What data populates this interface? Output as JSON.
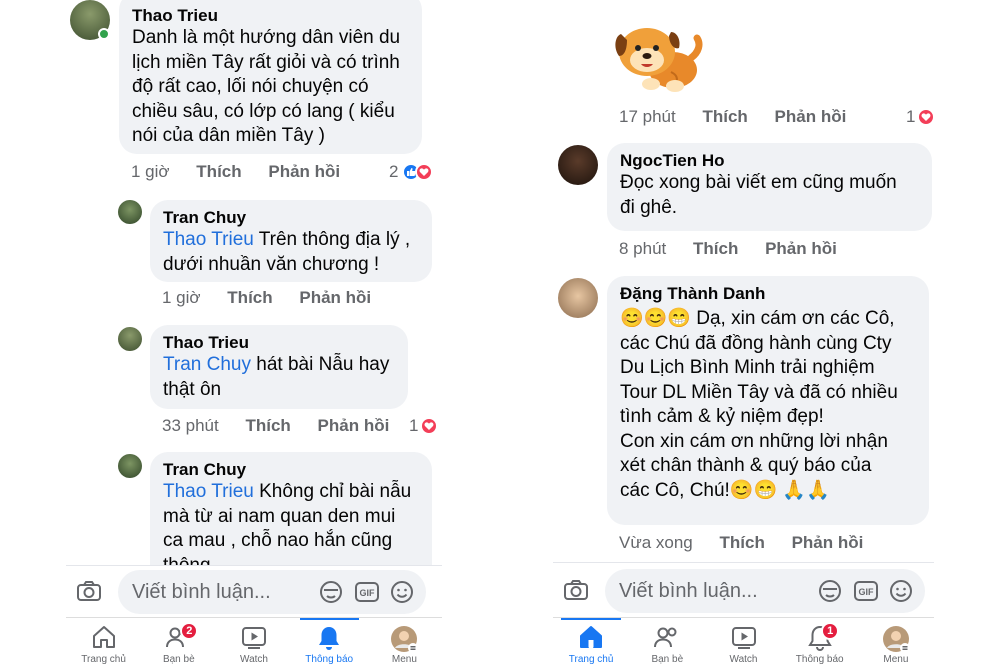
{
  "left": {
    "comments": [
      {
        "name": "Thao Trieu",
        "lines": [
          "Danh là một hướng dân viên du",
          "lịch miền Tây rất giỏi và có trình",
          "độ rất cao, lối nói chuyện có",
          "chiều sâu, có lớp có lang ( kiểu",
          "nói của dân miền Tây )"
        ],
        "time": "1 giờ",
        "like": "Thích",
        "reply": "Phản hồi",
        "reaction_count": "2"
      },
      {
        "name": "Tran Chuy",
        "mention": "Thao Trieu",
        "lines": [
          " Trên thông địa lý ,",
          "dưới nhuần văn chương !"
        ],
        "time": "1 giờ",
        "like": "Thích",
        "reply": "Phản hồi"
      },
      {
        "name": "Thao Trieu",
        "mention": "Tran Chuy",
        "lines": [
          " hát bài Nẫu hay",
          "thật ôn"
        ],
        "time": "33 phút",
        "like": "Thích",
        "reply": "Phản hồi",
        "reaction_count": "1"
      },
      {
        "name": "Tran Chuy",
        "mention": "Thao Trieu",
        "lines": [
          " Không chỉ bài nẫu",
          "mà từ ai nam quan den mui",
          "ca mau , chỗ nao hắn cũng",
          "thông"
        ]
      }
    ],
    "composer_placeholder": "Viết bình luận...",
    "nav": [
      {
        "label": "Trang chủ",
        "icon": "home-icon"
      },
      {
        "label": "Bạn bè",
        "icon": "friends-icon",
        "badge": "2"
      },
      {
        "label": "Watch",
        "icon": "watch-icon"
      },
      {
        "label": "Thông báo",
        "icon": "bell-icon"
      },
      {
        "label": "Menu",
        "icon": "menu-avatar-icon"
      }
    ]
  },
  "right": {
    "sticker_meta": {
      "time": "17 phút",
      "like": "Thích",
      "reply": "Phản hồi",
      "reaction_count": "1"
    },
    "comments": [
      {
        "name": "NgocTien Ho",
        "lines": [
          "Đọc xong bài viết em cũng muốn",
          "đi ghê."
        ],
        "time": "8 phút",
        "like": "Thích",
        "reply": "Phản hồi"
      },
      {
        "name": "Đặng Thành Danh",
        "lines": [
          "😊😊😁 Dạ, xin cám ơn các Cô,",
          "các Chú đã đồng hành cùng Cty",
          "Du Lịch Bình Minh trải nghiệm",
          "Tour DL Miền Tây và đã có nhiều",
          "tình cảm & kỷ niệm đẹp!",
          "Con xin cám ơn những lời nhận",
          "xét chân thành & quý báo của",
          "các Cô, Chú!😊😁 🙏🙏"
        ],
        "time": "Vừa xong",
        "like": "Thích",
        "reply": "Phản hồi"
      }
    ],
    "composer_placeholder": "Viết bình luận...",
    "nav": [
      {
        "label": "Trang chủ",
        "icon": "home-icon"
      },
      {
        "label": "Bạn bè",
        "icon": "friends-icon"
      },
      {
        "label": "Watch",
        "icon": "watch-icon"
      },
      {
        "label": "Thông báo",
        "icon": "bell-icon",
        "badge": "1"
      },
      {
        "label": "Menu",
        "icon": "menu-avatar-icon"
      }
    ]
  },
  "colors": {
    "accent": "#1877f2",
    "mention": "#216fdb",
    "bubble": "#f0f2f5",
    "badge": "#e41e3f"
  }
}
